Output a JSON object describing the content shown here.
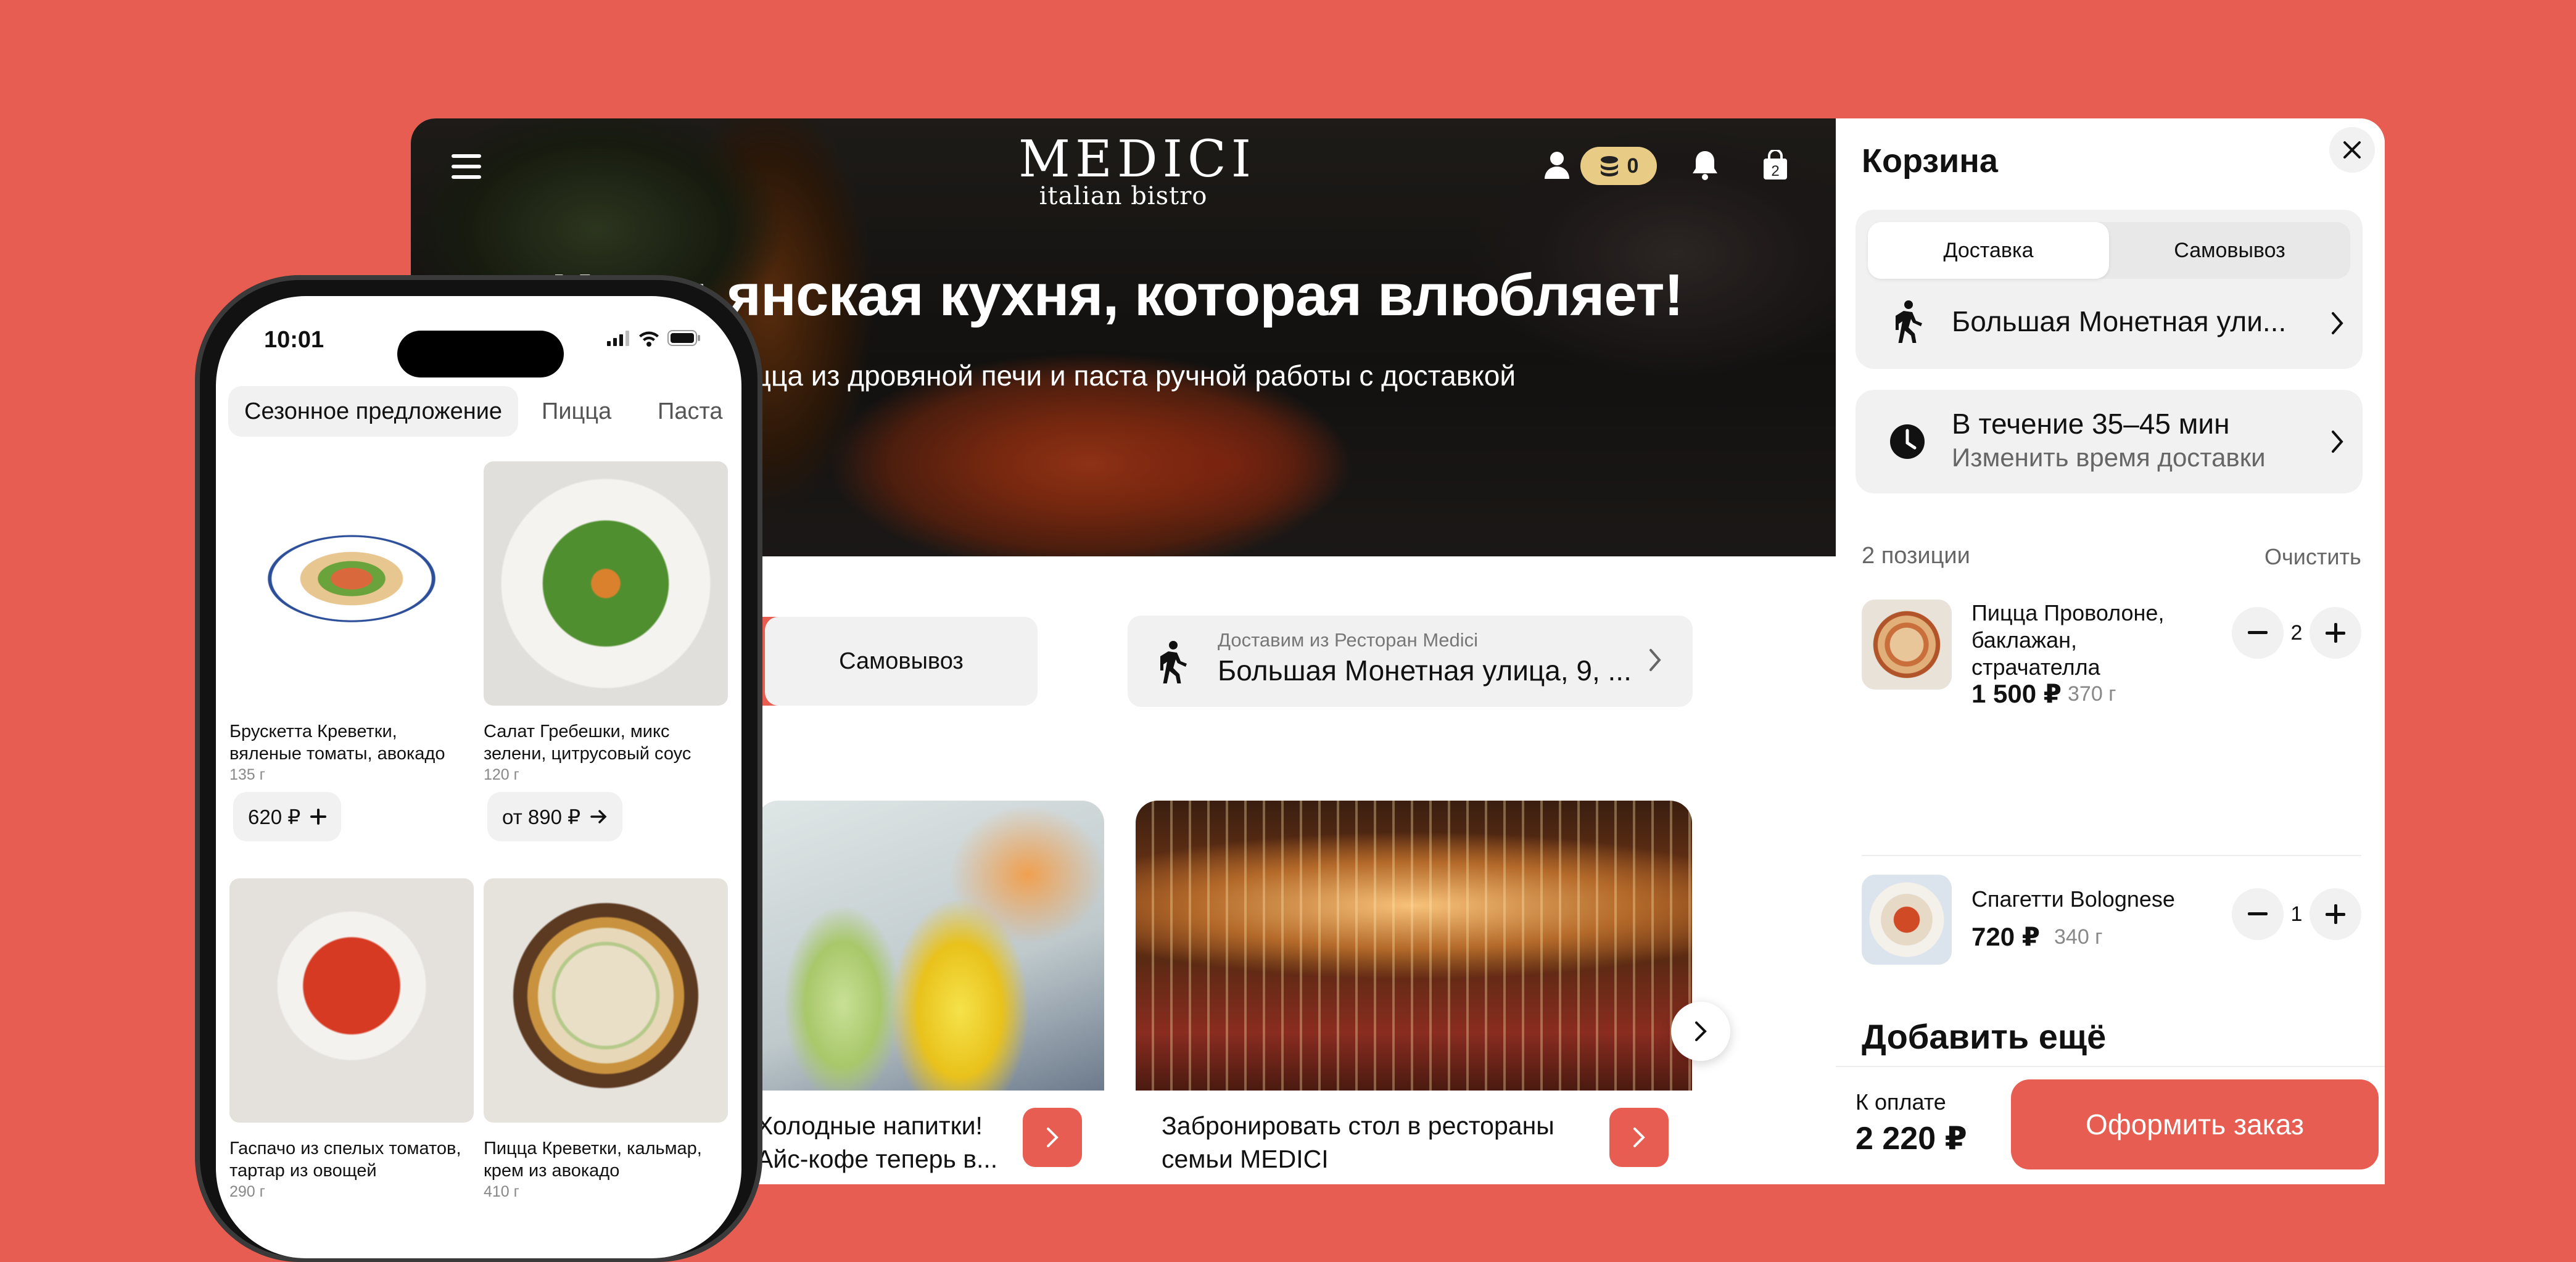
{
  "desktop": {
    "header": {
      "logo_main": "MEDICI",
      "logo_sub": "italian bistro",
      "coins_count": "0",
      "cart_badge": "2"
    },
    "hero": {
      "title": "Итальянская кухня, которая влюбляет!",
      "subtitle": "Пицца из дровяной печи и паста ручной работы с доставкой"
    },
    "delivery_bar": {
      "pickup_label": "Самовывоз",
      "address_caption": "Доставим из Ресторан Medici",
      "address_value": "Большая Монетная улица, 9, ..."
    },
    "promos": [
      {
        "text_line1": "Холодные напитки!",
        "text_line2": "Айс-кофе теперь в..."
      },
      {
        "text_line1": "Забронировать стол в рестораны",
        "text_line2": "семьи MEDICI"
      }
    ]
  },
  "cart": {
    "title": "Корзина",
    "tabs": [
      {
        "label": "Доставка",
        "active": true
      },
      {
        "label": "Самовывоз",
        "active": false
      }
    ],
    "address": "Большая Монетная ули...",
    "time_main": "В течение 35–45 мин",
    "time_change": "Изменить время доставки",
    "count_label": "2 позиции",
    "clear_label": "Очистить",
    "items": [
      {
        "name_line1": "Пицца Проволоне,",
        "name_line2": "баклажан,",
        "name_line3": "страчателла",
        "price": "1 500 ₽",
        "weight": "370 г",
        "qty": "2"
      },
      {
        "name_line1": "Спагетти Bolognese",
        "price": "720 ₽",
        "weight": "340 г",
        "qty": "1"
      }
    ],
    "add_more_title": "Добавить ещё",
    "pay_label": "К оплате",
    "pay_total": "2 220 ₽",
    "checkout_label": "Оформить заказ"
  },
  "phone": {
    "status_time": "10:01",
    "categories": [
      "Сезонное предложение",
      "Пицца",
      "Паста"
    ],
    "products": [
      {
        "name_line1": "Брускетта Креветки,",
        "name_line2": "вяленые томаты, авокадо",
        "weight": "135 г",
        "price": "620 ₽"
      },
      {
        "name_line1": "Салат Гребешки, микс",
        "name_line2": "зелени, цитрусовый соус",
        "weight": "120 г",
        "price": "от 890 ₽"
      },
      {
        "name_line1": "Гаспачо из спелых томатов,",
        "name_line2": "тартар из овощей",
        "weight": "290 г",
        "price": ""
      },
      {
        "name_line1": "Пицца Креветки, кальмар,",
        "name_line2": "крем из авокадо",
        "weight": "410 г",
        "price": ""
      }
    ]
  },
  "colors": {
    "brand_red": "#E85D52",
    "coin_gold": "#E8CC86",
    "tile_grey": "#F1F1F1"
  }
}
